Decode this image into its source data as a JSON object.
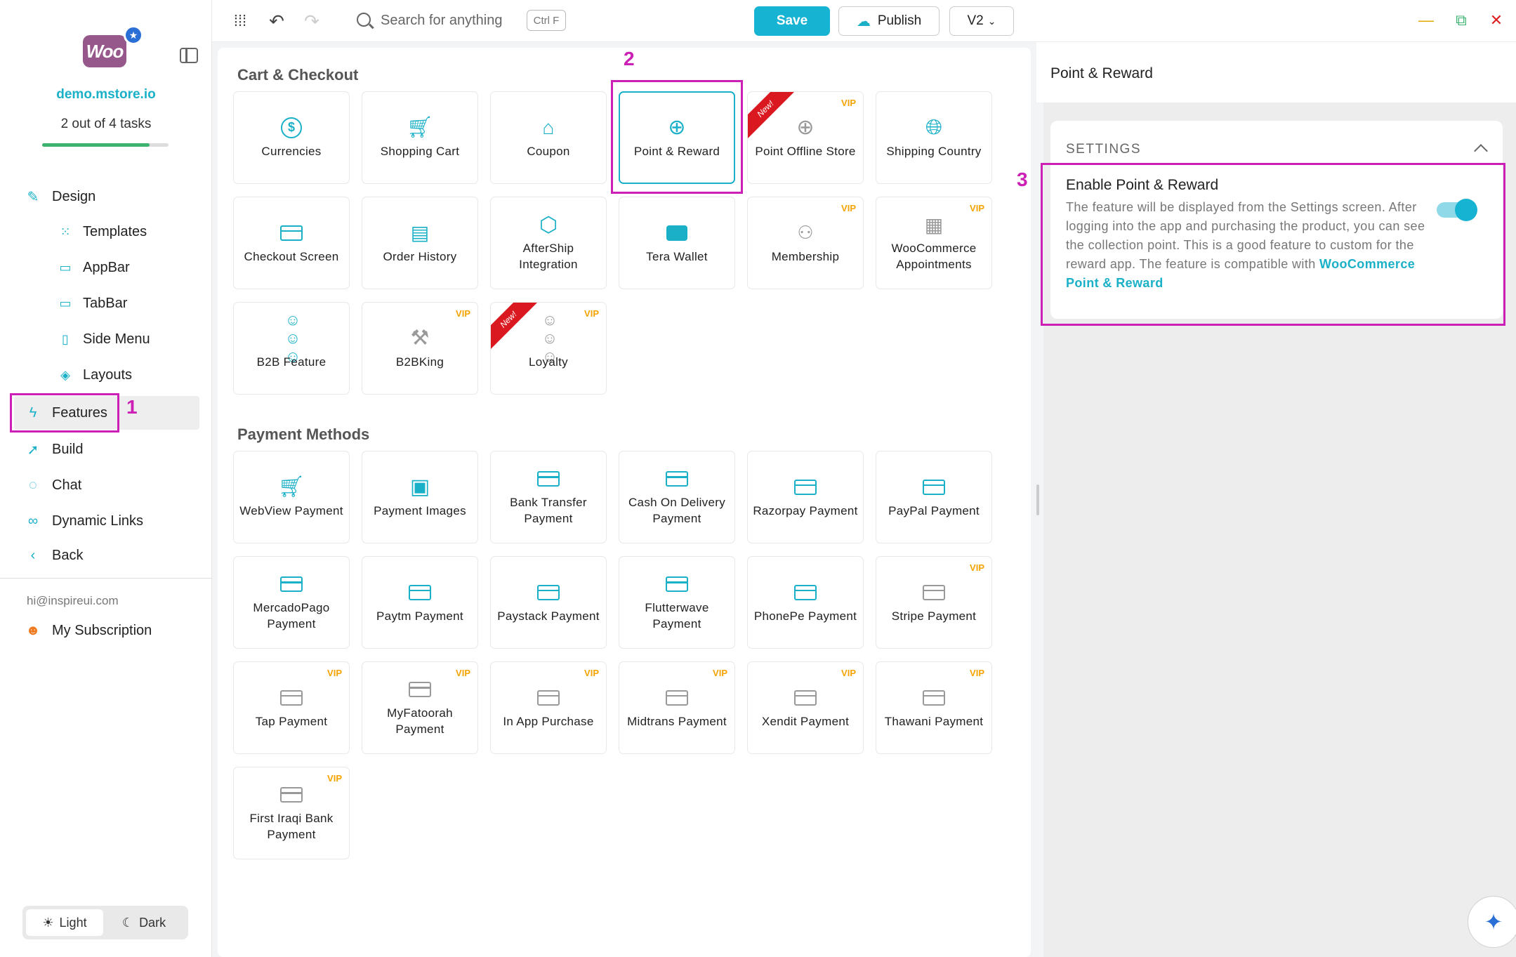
{
  "sidebar": {
    "logo_text": "Woo",
    "store_name": "demo.mstore.io",
    "tasks": "2 out of 4 tasks",
    "task_progress": 0.85,
    "nav": {
      "design": "Design",
      "templates": "Templates",
      "appbar": "AppBar",
      "tabbar": "TabBar",
      "side_menu": "Side Menu",
      "layouts": "Layouts",
      "features": "Features",
      "build": "Build",
      "chat": "Chat",
      "dynamic_links": "Dynamic Links",
      "back": "Back"
    },
    "email": "hi@inspireui.com",
    "subscription": "My Subscription",
    "theme": {
      "light": "Light",
      "dark": "Dark",
      "selected": "Light"
    }
  },
  "annotations": {
    "one": "1",
    "two": "2",
    "three": "3",
    "color": "#cc1fb5"
  },
  "topbar": {
    "search_placeholder": "Search for anything",
    "shortcut": "Ctrl F",
    "save": "Save",
    "publish": "Publish",
    "version": "V2",
    "accent": "#17b3d3"
  },
  "main": {
    "cart_section": "Cart & Checkout",
    "cart_cards": [
      {
        "label": "Currencies",
        "icon": "dollar-circle-icon"
      },
      {
        "label": "Shopping Cart",
        "icon": "cart-icon"
      },
      {
        "label": "Coupon",
        "icon": "tag-icon"
      },
      {
        "label": "Point & Reward",
        "icon": "bag-plus-icon",
        "selected": true
      },
      {
        "label": "Point Offline Store",
        "icon": "bag-plus-icon",
        "vip": "VIP",
        "ribbon": "New!"
      },
      {
        "label": "Shipping Country",
        "icon": "globe-icon"
      },
      {
        "label": "Checkout Screen",
        "icon": "credit-card-icon"
      },
      {
        "label": "Order History",
        "icon": "document-icon"
      },
      {
        "label": "AfterShip Integration",
        "icon": "box-icon"
      },
      {
        "label": "Tera Wallet",
        "icon": "wallet-icon"
      },
      {
        "label": "Membership",
        "icon": "users-icon",
        "vip": "VIP"
      },
      {
        "label": "WooCommerce Appointments",
        "icon": "calendar-icon",
        "vip": "VIP"
      },
      {
        "label": "B2B Feature",
        "icon": "group-icon"
      },
      {
        "label": "B2BKing",
        "icon": "hammer-icon",
        "vip": "VIP"
      },
      {
        "label": "Loyalty",
        "icon": "group-icon",
        "vip": "VIP",
        "ribbon": "New!"
      }
    ],
    "payment_section": "Payment Methods",
    "payment_cards": [
      {
        "label": "WebView Payment",
        "icon": "cart-plus-icon"
      },
      {
        "label": "Payment Images",
        "icon": "images-icon"
      },
      {
        "label": "Bank Transfer Payment",
        "icon": "credit-card-icon"
      },
      {
        "label": "Cash On Delivery Payment",
        "icon": "credit-card-icon"
      },
      {
        "label": "Razorpay Payment",
        "icon": "credit-card-icon"
      },
      {
        "label": "PayPal Payment",
        "icon": "credit-card-icon"
      },
      {
        "label": "MercadoPago Payment",
        "icon": "credit-card-icon"
      },
      {
        "label": "Paytm Payment",
        "icon": "credit-card-icon"
      },
      {
        "label": "Paystack Payment",
        "icon": "credit-card-icon"
      },
      {
        "label": "Flutterwave Payment",
        "icon": "credit-card-icon"
      },
      {
        "label": "PhonePe Payment",
        "icon": "credit-card-icon"
      },
      {
        "label": "Stripe Payment",
        "icon": "credit-card-icon",
        "vip": "VIP"
      },
      {
        "label": "Tap Payment",
        "icon": "credit-card-icon",
        "vip": "VIP"
      },
      {
        "label": "MyFatoorah Payment",
        "icon": "credit-card-icon",
        "vip": "VIP"
      },
      {
        "label": "In App Purchase",
        "icon": "credit-card-icon",
        "vip": "VIP"
      },
      {
        "label": "Midtrans Payment",
        "icon": "credit-card-icon",
        "vip": "VIP"
      },
      {
        "label": "Xendit Payment",
        "icon": "credit-card-icon",
        "vip": "VIP"
      },
      {
        "label": "Thawani Payment",
        "icon": "credit-card-icon",
        "vip": "VIP"
      },
      {
        "label": "First Iraqi Bank Payment",
        "icon": "credit-card-icon",
        "vip": "VIP"
      }
    ]
  },
  "right_panel": {
    "title": "Point & Reward",
    "settings_label": "SETTINGS",
    "option_title": "Enable Point & Reward",
    "option_desc": "The feature will be displayed from the Settings screen. After logging into the app and purchasing the product, you can see the collection point. This is a good feature to custom for the reward app. The feature is compatible with ",
    "option_link": "WooCommerce Point & Reward",
    "enabled": true
  }
}
